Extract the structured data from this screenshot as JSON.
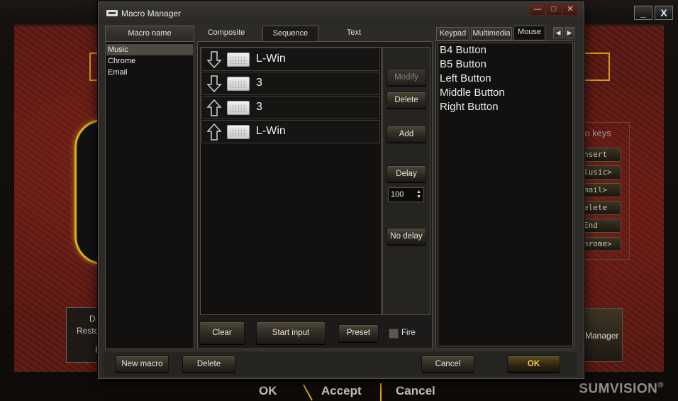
{
  "background": {
    "window_controls": [
      "_",
      "X"
    ],
    "keys_title": "ro keys",
    "keys": [
      "nsert",
      "lusic>",
      "mail>",
      "elete",
      "End",
      "hrome>"
    ],
    "left_panel_lines": [
      "D",
      "Resto",
      "F"
    ],
    "manager_button": "Manager",
    "bottom": {
      "ok": "OK",
      "accept": "Accept",
      "cancel": "Cancel"
    },
    "brand": "SUMVISION",
    "brand_mark": "®"
  },
  "dialog": {
    "title": "Macro Manager",
    "title_buttons": [
      "—",
      "□",
      "✕"
    ],
    "macro_list": {
      "header": "Macro name",
      "items": [
        "Music",
        "Chrome",
        "Email"
      ],
      "selected": "Music"
    },
    "tabs": {
      "composite": "Composite",
      "sequence": "Sequence",
      "text": "Text",
      "active": "Sequence"
    },
    "sequence": [
      {
        "direction": "down",
        "icon": "keyboard-icon",
        "label": "L-Win"
      },
      {
        "direction": "down",
        "icon": "keyboard-icon",
        "label": "3"
      },
      {
        "direction": "up",
        "icon": "keyboard-icon",
        "label": "3"
      },
      {
        "direction": "up",
        "icon": "keyboard-icon",
        "label": "L-Win"
      }
    ],
    "side_buttons": {
      "modify": "Modify",
      "delete": "Delete",
      "add": "Add",
      "delay": "Delay",
      "delay_value": "100",
      "no_delay": "No delay"
    },
    "sequence_footer": {
      "clear": "Clear",
      "start_input": "Start input",
      "preset": "Preset",
      "fire": "Fire",
      "fire_checked": false
    },
    "right_tabs": {
      "keypad": "Keypad",
      "multimedia": "Multimedia",
      "mouse": "Mouse",
      "active": "Mouse",
      "prev": "◀",
      "next": "▶"
    },
    "mouse_items": [
      "B4 Button",
      "B5 Button",
      "Left Button",
      "Middle Button",
      "Right Button"
    ],
    "footer": {
      "new_macro": "New macro",
      "delete": "Delete",
      "cancel": "Cancel",
      "ok": "OK"
    }
  }
}
